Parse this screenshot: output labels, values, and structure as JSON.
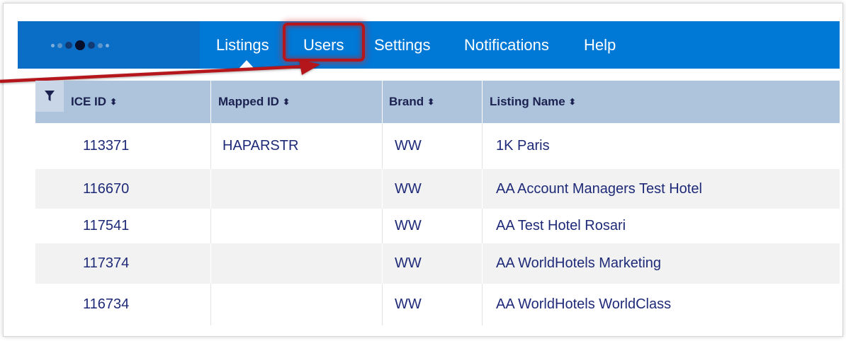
{
  "nav": {
    "items": [
      {
        "label": "Listings"
      },
      {
        "label": "Users"
      },
      {
        "label": "Settings"
      },
      {
        "label": "Notifications"
      },
      {
        "label": "Help"
      }
    ]
  },
  "table": {
    "columns": [
      "ICE ID",
      "Mapped ID",
      "Brand",
      "Listing Name"
    ],
    "sort_glyph": "⬍",
    "rows": [
      {
        "ice_id": "113371",
        "mapped_id": "HAPARSTR",
        "brand": "WW",
        "listing_name": "1K Paris"
      },
      {
        "ice_id": "116670",
        "mapped_id": "",
        "brand": "WW",
        "listing_name": "AA Account Managers Test Hotel"
      },
      {
        "ice_id": "117541",
        "mapped_id": "",
        "brand": "WW",
        "listing_name": "AA Test Hotel Rosari"
      },
      {
        "ice_id": "117374",
        "mapped_id": "",
        "brand": "WW",
        "listing_name": "AA WorldHotels Marketing"
      },
      {
        "ice_id": "116734",
        "mapped_id": "",
        "brand": "WW",
        "listing_name": "AA WorldHotels WorldClass"
      }
    ]
  },
  "colors": {
    "nav_bg": "#0078d6",
    "header_bg": "#aec3dc",
    "row_alt": "#f2f2f2",
    "text": "#1e2a78",
    "highlight": "#b5161b"
  },
  "icons": {
    "logo": "dots-logo-icon",
    "filter": "filter-icon",
    "callout": "callout-arrow-icon"
  }
}
